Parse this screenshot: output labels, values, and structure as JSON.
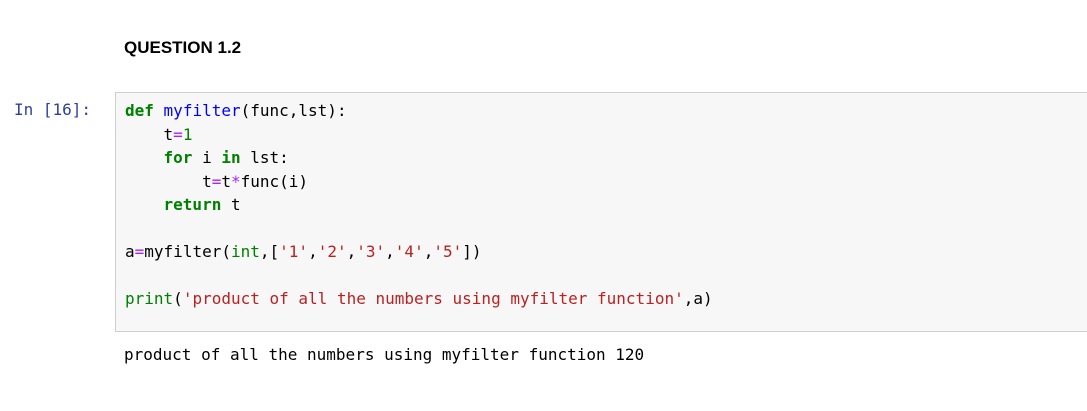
{
  "markdown_cell": {
    "heading": "QUESTION 1.2"
  },
  "code_cell": {
    "prompt": "In [16]:",
    "tokens": {
      "l1_def": "def",
      "l1_name": "myfilter",
      "l1_rest": "(func,lst):",
      "l2_t": "t",
      "l2_eq": "=",
      "l2_num": "1",
      "l3_for": "for",
      "l3_i": " i ",
      "l3_in": "in",
      "l3_rest": " lst:",
      "l4_t": "t",
      "l4_eq": "=",
      "l4_t2": "t",
      "l4_mul": "*",
      "l4_rest": "func(i)",
      "l5_return": "return",
      "l5_rest": " t",
      "l7_a": "a",
      "l7_eq": "=",
      "l7_call": "myfilter(",
      "l7_int": "int",
      "l7_lb": ",[",
      "l7_s1": "'1'",
      "l7_c1": ",",
      "l7_s2": "'2'",
      "l7_c2": ",",
      "l7_s3": "'3'",
      "l7_c3": ",",
      "l7_s4": "'4'",
      "l7_c4": ",",
      "l7_s5": "'5'",
      "l7_end": "])",
      "l9_print": "print",
      "l9_lp": "(",
      "l9_str": "'product of all the numbers using myfilter function'",
      "l9_end": ",a)"
    }
  },
  "output_cell": {
    "text": "product of all the numbers using myfilter function 120"
  },
  "colors": {
    "keyword": "#008000",
    "function_name": "#0000ff",
    "operator": "#aa22ff",
    "string": "#ba2121",
    "prompt": "#303f9f",
    "cell_background": "#f7f7f7",
    "cell_border": "#cfcfcf"
  }
}
